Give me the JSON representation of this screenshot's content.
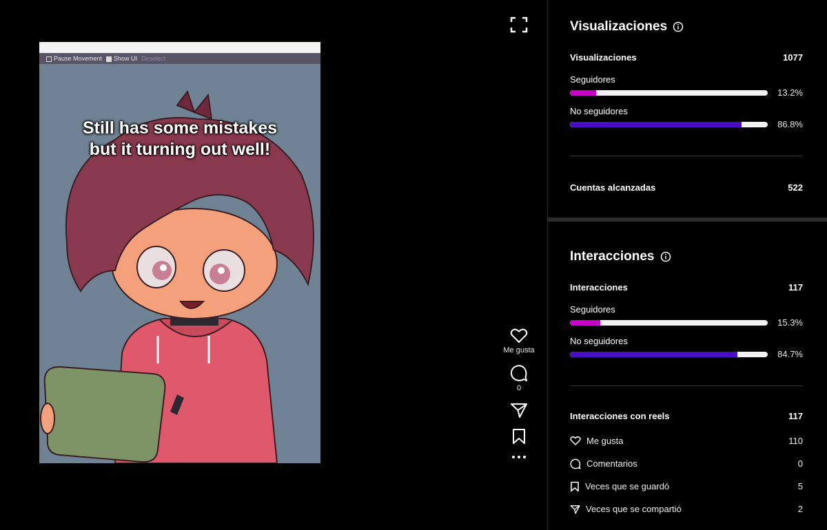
{
  "media": {
    "toolbar": {
      "pause": "Pause Movement",
      "show_ui": "Show UI",
      "deselect": "Deselect"
    },
    "caption_line1": "Still has some mistakes",
    "caption_line2": "but it turning out well!"
  },
  "actions": {
    "like_label": "Me gusta",
    "comment_count": "0"
  },
  "views": {
    "title": "Visualizaciones",
    "total_label": "Visualizaciones",
    "total_value": "1077",
    "followers_label": "Seguidores",
    "followers_pct": "13.2%",
    "followers_fraction": 0.132,
    "nonfollowers_label": "No seguidores",
    "nonfollowers_pct": "86.8%",
    "nonfollowers_fraction": 0.868,
    "reach_label": "Cuentas alcanzadas",
    "reach_value": "522"
  },
  "interactions": {
    "title": "Interacciones",
    "total_label": "Interacciones",
    "total_value": "117",
    "followers_label": "Seguidores",
    "followers_pct": "15.3%",
    "followers_fraction": 0.153,
    "nonfollowers_label": "No seguidores",
    "nonfollowers_pct": "84.7%",
    "nonfollowers_fraction": 0.847,
    "reels_label": "Interacciones con reels",
    "reels_value": "117",
    "items": [
      {
        "icon": "heart-icon",
        "label": "Me gusta",
        "value": "110"
      },
      {
        "icon": "comment-icon",
        "label": "Comentarios",
        "value": "0"
      },
      {
        "icon": "bookmark-icon",
        "label": "Veces que se guardó",
        "value": "5"
      },
      {
        "icon": "share-icon",
        "label": "Veces que se compartió",
        "value": "2"
      }
    ]
  },
  "colors": {
    "followers": "#c800c8",
    "nonfollowers": "#4a0ec8",
    "track": "#f2f2f2"
  }
}
